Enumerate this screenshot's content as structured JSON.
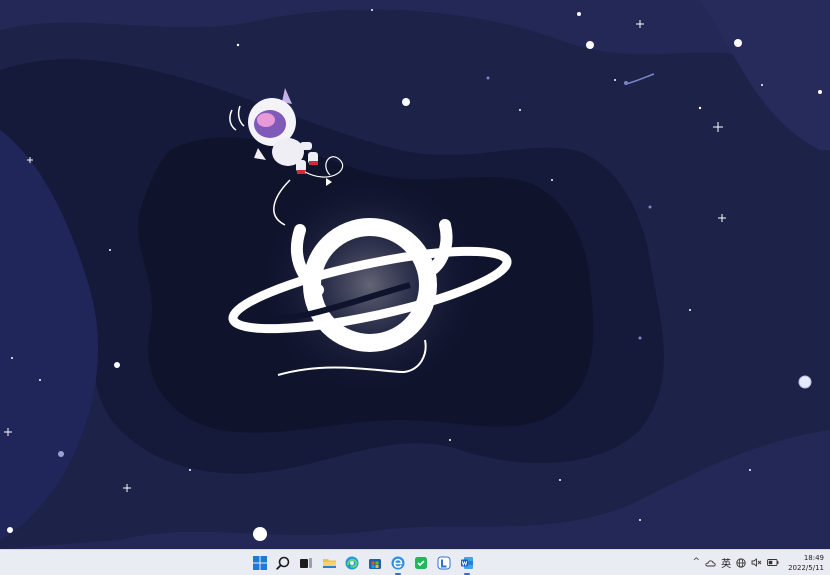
{
  "desktop": {
    "background": "#1d2147",
    "wallpaper": "space-astronaut-planet-logo"
  },
  "taskbar": {
    "apps": [
      {
        "name": "start",
        "icon": "windows-start-icon",
        "active": false
      },
      {
        "name": "search",
        "icon": "search-icon",
        "active": false
      },
      {
        "name": "task-view",
        "icon": "task-view-icon",
        "active": false
      },
      {
        "name": "file-explorer",
        "icon": "folder-icon",
        "active": false
      },
      {
        "name": "edge",
        "icon": "edge-browser-icon",
        "active": false
      },
      {
        "name": "store",
        "icon": "store-icon",
        "active": false
      },
      {
        "name": "browser-2",
        "icon": "blue-e-browser-icon",
        "active": true
      },
      {
        "name": "wechat",
        "icon": "green-chat-icon",
        "active": false
      },
      {
        "name": "app-blue",
        "icon": "blue-app-icon",
        "active": false
      },
      {
        "name": "word",
        "icon": "word-icon",
        "active": true
      }
    ],
    "tray": {
      "chevron": "^",
      "ime_label": "英",
      "time": "18:49",
      "date": "2022/5/11"
    }
  }
}
